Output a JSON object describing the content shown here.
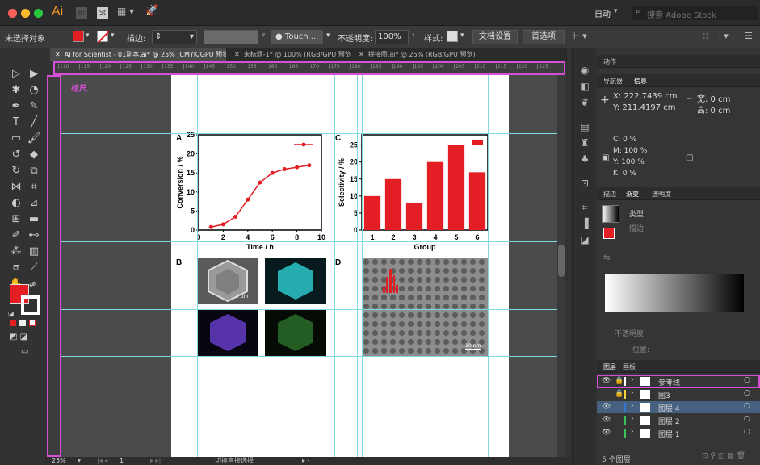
{
  "app": {
    "logo": "Ai",
    "bridge": "Br",
    "stock": "St",
    "workspace": "自动",
    "search_placeholder": "搜索 Adobe Stock"
  },
  "control": {
    "selection": "未选择对象",
    "stroke_label": "描边:",
    "brush": "Touch ...",
    "opacity_label": "不透明度:",
    "opacity_value": "100%",
    "style_label": "样式:",
    "doc_setup": "文档设置",
    "prefs": "首选项"
  },
  "tabs": [
    {
      "label": "AI for Scientist - 01副本.ai* @ 25% (CMYK/GPU 预览)"
    },
    {
      "label": "未标题-1* @ 100% (RGB/GPU 预览)"
    },
    {
      "label": "拼接图.ai* @ 25% (RGB/GPU 预览)"
    }
  ],
  "ruler": {
    "ticks": [
      "110",
      "115",
      "120",
      "125",
      "130",
      "135",
      "140",
      "145",
      "150",
      "155",
      "160",
      "165",
      "170",
      "175",
      "180",
      "185",
      "190",
      "195",
      "200",
      "205",
      "210",
      "215",
      "220",
      "225"
    ],
    "annotation": "标尺"
  },
  "status": {
    "zoom": "25%",
    "page": "1",
    "tool": "切换直接选择"
  },
  "figure": {
    "panel_a": "A",
    "panel_b": "B",
    "panel_c": "C",
    "panel_d": "D",
    "scale_b": "2 µm",
    "scale_d": "10 nm"
  },
  "chart_data": [
    {
      "type": "line",
      "x": [
        1,
        2,
        3,
        4,
        5,
        6,
        7,
        8,
        9
      ],
      "series": [
        {
          "values": [
            0.8,
            1.5,
            3.5,
            8,
            12.5,
            15,
            16,
            16.5,
            17
          ]
        }
      ],
      "xlabel": "Time / h",
      "ylabel": "Conversion / %",
      "xlim": [
        0,
        10
      ],
      "ylim": [
        0,
        25
      ],
      "xticks": [
        "0",
        "2",
        "4",
        "6",
        "8",
        "10"
      ],
      "yticks": [
        "0",
        "5",
        "10",
        "15",
        "20",
        "25"
      ],
      "color": "#e31e24"
    },
    {
      "type": "bar",
      "categories": [
        "1",
        "2",
        "3",
        "4",
        "5",
        "6"
      ],
      "values": [
        10,
        15,
        8,
        20,
        25,
        17
      ],
      "xlabel": "Group",
      "ylabel": "Selectivity / %",
      "ylim": [
        0,
        28
      ],
      "yticks": [
        "0",
        "5",
        "10",
        "15",
        "20",
        "25"
      ],
      "color": "#e31e24"
    }
  ],
  "panels": {
    "actions_tab": "动作",
    "nav_tab": "导航器",
    "info_tab": "信息",
    "x": "X: 222.7439 cm",
    "y": "Y: 211.4197 cm",
    "w": "宽: 0 cm",
    "h": "高: 0 cm",
    "c": "C: 0 %",
    "m": "M: 100 %",
    "yv": "Y: 100 %",
    "k": "K: 0 %",
    "stroke_tab": "描边",
    "gradient_tab": "渐变",
    "transparency_tab": "透明度",
    "type_label": "类型:",
    "stroke_label": "描边:",
    "opacity_label": "不透明度:",
    "position_label": "位置:",
    "layers_tab": "图层",
    "artboards_tab": "画板",
    "layer_count": "5 个图层"
  },
  "layers": [
    {
      "name": "参考线",
      "color": "#ffffff"
    },
    {
      "name": "图3",
      "color": "#f2d43a"
    },
    {
      "name": "图层 4",
      "color": "#3a78d6"
    },
    {
      "name": "图层 2",
      "color": "#3ac35a"
    },
    {
      "name": "图层 1",
      "color": "#3ac35a"
    }
  ],
  "colors": {
    "highlight": "#d64fd6",
    "guide": "#7fd9e0",
    "fill_swatch": "#e31e24"
  }
}
